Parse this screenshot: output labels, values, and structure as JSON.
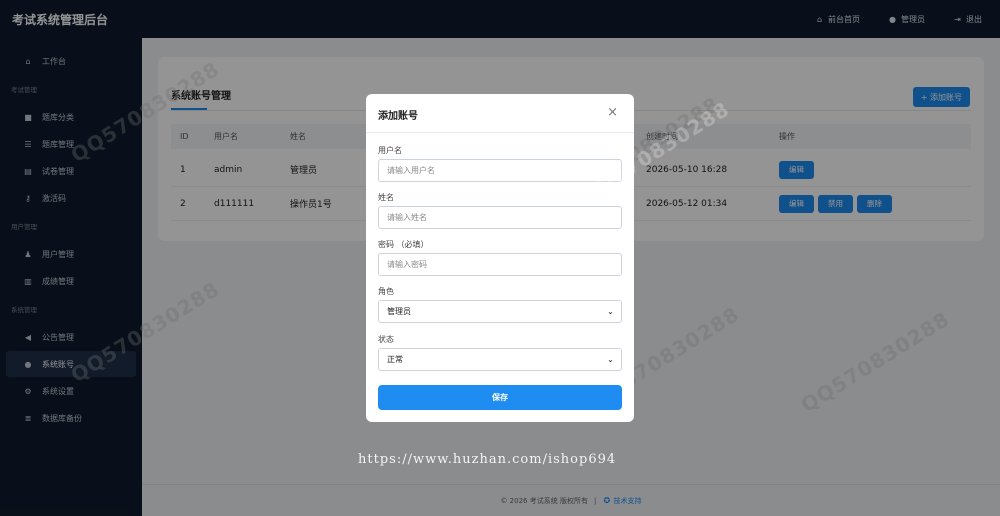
{
  "app": {
    "title": "考试系统管理后台",
    "top_links": [
      {
        "label": "前台首页",
        "icon": "home-icon"
      },
      {
        "label": "管理员",
        "icon": "user-circle-icon"
      },
      {
        "label": "退出",
        "icon": "logout-icon"
      }
    ]
  },
  "sidebar": {
    "dashboard": {
      "label": "工作台",
      "icon": "home-icon"
    },
    "group_exam": "考试管理",
    "exam_items": [
      {
        "label": "题库分类",
        "icon": "folder-icon"
      },
      {
        "label": "题库管理",
        "icon": "list-icon"
      },
      {
        "label": "试卷管理",
        "icon": "document-icon"
      },
      {
        "label": "激活码",
        "icon": "key-icon"
      }
    ],
    "group_user": "用户管理",
    "user_items": [
      {
        "label": "用户管理",
        "icon": "users-icon"
      },
      {
        "label": "成绩管理",
        "icon": "bar-chart-icon"
      }
    ],
    "group_system": "系统管理",
    "system_items": [
      {
        "label": "公告管理",
        "icon": "megaphone-icon"
      },
      {
        "label": "系统账号",
        "icon": "account-icon",
        "active": true
      },
      {
        "label": "系统设置",
        "icon": "gear-icon"
      },
      {
        "label": "数据库备份",
        "icon": "database-icon"
      }
    ]
  },
  "page": {
    "title": "系统账号管理",
    "add_button": "+ 添加账号",
    "columns": [
      "ID",
      "用户名",
      "姓名",
      "创建时间",
      "操作"
    ],
    "rows": [
      {
        "id": "1",
        "username": "admin",
        "name": "管理员",
        "created": "2026-05-10 16:28",
        "ops": [
          "编辑"
        ]
      },
      {
        "id": "2",
        "username": "d111111",
        "name": "操作员1号",
        "created": "2026-05-12 01:34",
        "ops": [
          "编辑",
          "禁用",
          "删除"
        ]
      }
    ]
  },
  "footer": {
    "copyright": "© 2026 考试系统 版权所有",
    "separator": "|",
    "support": "技术支持"
  },
  "modal": {
    "title": "添加账号",
    "close": "×",
    "fields": {
      "username": {
        "label": "用户名",
        "placeholder": "请输入用户名"
      },
      "name": {
        "label": "姓名",
        "placeholder": "请输入姓名"
      },
      "password": {
        "label": "密码 （必填）",
        "placeholder": "请输入密码"
      },
      "role": {
        "label": "角色",
        "value": "管理员"
      },
      "status": {
        "label": "状态",
        "value": "正常"
      }
    },
    "save": "保存"
  },
  "watermark": {
    "text": "QQ570830288",
    "url": "https://www.huzhan.com/ishop694"
  },
  "colors": {
    "primary": "#1e8cf0",
    "sidebar": "#0f1b2d"
  }
}
